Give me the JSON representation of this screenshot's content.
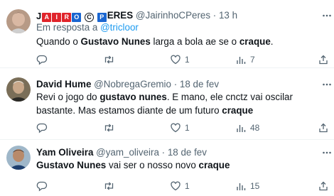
{
  "tweets": [
    {
      "name_letters": [
        "J",
        "A",
        "I",
        "R",
        "O",
        "C",
        "P",
        "ERES"
      ],
      "handle": "@JairinhoCPeres",
      "dot": "·",
      "time": "13 h",
      "reply_prefix": "Em resposta a",
      "reply_to": "@tricloor",
      "body": [
        {
          "t": "Quando o "
        },
        {
          "t": "Gustavo Nunes",
          "b": true
        },
        {
          "t": " larga a bola ae se o "
        },
        {
          "t": "craque",
          "b": true
        },
        {
          "t": "."
        }
      ],
      "actions": {
        "reply": "",
        "retweet": "",
        "like": "1",
        "views": "7"
      }
    },
    {
      "name": "David Hume",
      "handle": "@NobregaGremio",
      "dot": "·",
      "time": "18 de fev",
      "body": [
        {
          "t": "Revi o jogo do "
        },
        {
          "t": "gustavo nunes",
          "b": true
        },
        {
          "t": ". E mano, ele cnctz vai oscilar bastante. Mas estamos diante de um futuro "
        },
        {
          "t": "craque",
          "b": true
        }
      ],
      "actions": {
        "reply": "",
        "retweet": "",
        "like": "1",
        "views": "48"
      }
    },
    {
      "name": "Yam Oliveira",
      "handle": "@yam_oliveira",
      "dot": "·",
      "time": "18 de fev",
      "body": [
        {
          "t": "Gustavo Nunes",
          "b": true
        },
        {
          "t": " vai ser o nosso novo "
        },
        {
          "t": "craque",
          "b": true
        }
      ],
      "actions": {
        "reply": "",
        "retweet": "",
        "like": "1",
        "views": "15"
      }
    }
  ],
  "icons": {
    "reply": "reply-icon",
    "retweet": "retweet-icon",
    "like": "heart-icon",
    "views": "views-bar-chart-icon",
    "share": "share-icon",
    "more": "more-icon"
  },
  "colors": {
    "text": "#0f1419",
    "muted": "#536471",
    "link": "#1d9bf0",
    "divider": "#eff3f4",
    "badge_red": "#e0242b",
    "badge_blue": "#1a66d1"
  }
}
